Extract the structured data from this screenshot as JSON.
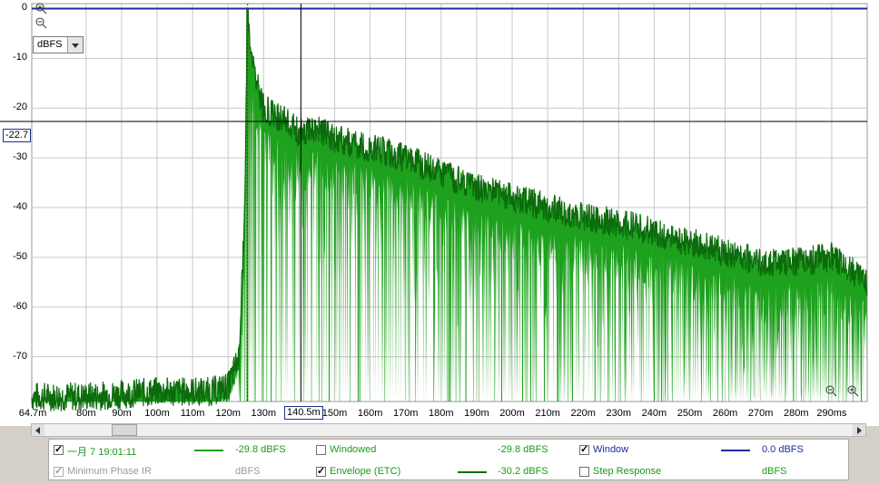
{
  "unit_select": "dBFS",
  "cursor": {
    "y_readout": "-22.7",
    "x_readout": "140.5m"
  },
  "colors": {
    "plot_bg": "#ffffff",
    "grid": "#c8c8c8",
    "etc_fill": "#1ea11e",
    "etc_line": "#0b6b0b",
    "window_line": "#1b2d9a",
    "cursor_line": "#000000",
    "peak_marker": "#c00000",
    "disabled_text": "#9a9a9a",
    "green_text": "#1a9a1a",
    "blue_text": "#1b2d9a"
  },
  "chart_data": {
    "type": "area",
    "title": "",
    "xlabel": "",
    "ylabel": "",
    "xlim_ms": [
      64.7,
      300
    ],
    "ylim_dbfs": [
      -79,
      1
    ],
    "x_ticks": [
      "64.7m",
      "80m",
      "90m",
      "100m",
      "110m",
      "120m",
      "130m",
      "140.5m",
      "150m",
      "160m",
      "170m",
      "180m",
      "190m",
      "200m",
      "210m",
      "220m",
      "230m",
      "240m",
      "250m",
      "260m",
      "270m",
      "280m",
      "290ms"
    ],
    "y_ticks": [
      "0",
      "-10",
      "-20",
      "-30",
      "-40",
      "-50",
      "-60",
      "-70"
    ],
    "series": [
      {
        "name": "Envelope (ETC)",
        "points_ms_db": [
          [
            64.7,
            -78
          ],
          [
            80,
            -78
          ],
          [
            100,
            -77
          ],
          [
            115,
            -77
          ],
          [
            120,
            -76
          ],
          [
            123,
            -70
          ],
          [
            124.5,
            -45
          ],
          [
            125.5,
            0
          ],
          [
            126.5,
            -10
          ],
          [
            128,
            -15
          ],
          [
            130,
            -20
          ],
          [
            135,
            -22
          ],
          [
            140,
            -25
          ],
          [
            145,
            -24
          ],
          [
            150,
            -26
          ],
          [
            160,
            -28
          ],
          [
            170,
            -30
          ],
          [
            180,
            -33
          ],
          [
            190,
            -36
          ],
          [
            200,
            -38
          ],
          [
            210,
            -40
          ],
          [
            220,
            -42
          ],
          [
            230,
            -43
          ],
          [
            240,
            -45
          ],
          [
            250,
            -47
          ],
          [
            260,
            -49
          ],
          [
            270,
            -51
          ],
          [
            280,
            -51
          ],
          [
            290,
            -50
          ],
          [
            300,
            -55
          ]
        ]
      },
      {
        "name": "Window",
        "points_ms_db": [
          [
            64.7,
            0
          ],
          [
            300,
            0
          ]
        ]
      }
    ],
    "grid": true
  },
  "legend": {
    "rows": [
      [
        {
          "label": "一月 7 19:01:11",
          "value": "-29.8 dBFS",
          "checked": true,
          "disabled": false,
          "text_color": "#1a9a1a",
          "swatch": "#1ea11e"
        },
        {
          "label": "Windowed",
          "value": "-29.8 dBFS",
          "checked": false,
          "disabled": false,
          "text_color": "#1a9a1a",
          "swatch": ""
        },
        {
          "label": "Window",
          "value": "0.0 dBFS",
          "checked": true,
          "disabled": false,
          "text_color": "#1b2d9a",
          "swatch": "#1b2d9a"
        }
      ],
      [
        {
          "label": "Minimum Phase IR",
          "value": "dBFS",
          "checked": true,
          "disabled": true,
          "text_color": "#9a9a9a",
          "swatch": ""
        },
        {
          "label": "Envelope (ETC)",
          "value": "-30.2 dBFS",
          "checked": true,
          "disabled": false,
          "text_color": "#1a9a1a",
          "swatch": "#0b6b0b"
        },
        {
          "label": "Step Response",
          "value": "dBFS",
          "checked": false,
          "disabled": false,
          "text_color": "#1a9a1a",
          "swatch": ""
        }
      ]
    ]
  }
}
